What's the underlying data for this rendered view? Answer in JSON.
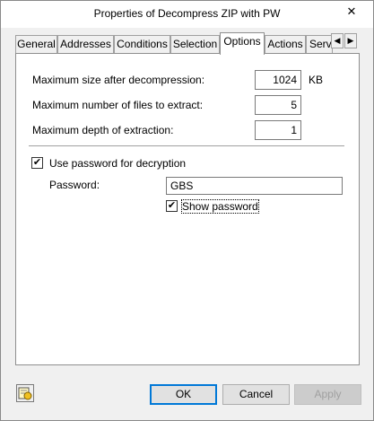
{
  "window": {
    "title": "Properties of Decompress ZIP with PW",
    "close_symbol": "✕"
  },
  "tabs": [
    {
      "label": "General",
      "active": false
    },
    {
      "label": "Addresses",
      "active": false
    },
    {
      "label": "Conditions",
      "active": false
    },
    {
      "label": "Selection",
      "active": false
    },
    {
      "label": "Options",
      "active": true
    },
    {
      "label": "Actions",
      "active": false
    },
    {
      "label": "Serv",
      "active": false
    }
  ],
  "tab_scroll": {
    "left_symbol": "◀",
    "right_symbol": "▶"
  },
  "options": {
    "max_size_label": "Maximum size after decompression:",
    "max_size_value": "1024",
    "max_size_unit": "KB",
    "max_files_label": "Maximum number of files to extract:",
    "max_files_value": "5",
    "max_depth_label": "Maximum depth of extraction:",
    "max_depth_value": "1",
    "use_password_label": "Use password for decryption",
    "use_password_checked": true,
    "password_label": "Password:",
    "password_value": "GBS",
    "show_password_label": "Show password",
    "show_password_checked": true,
    "check_mark": "✔"
  },
  "buttons": {
    "ok": "OK",
    "cancel": "Cancel",
    "apply": "Apply"
  },
  "colors": {
    "focus_border": "#0078d7",
    "disabled_text": "#a0a0a0"
  }
}
